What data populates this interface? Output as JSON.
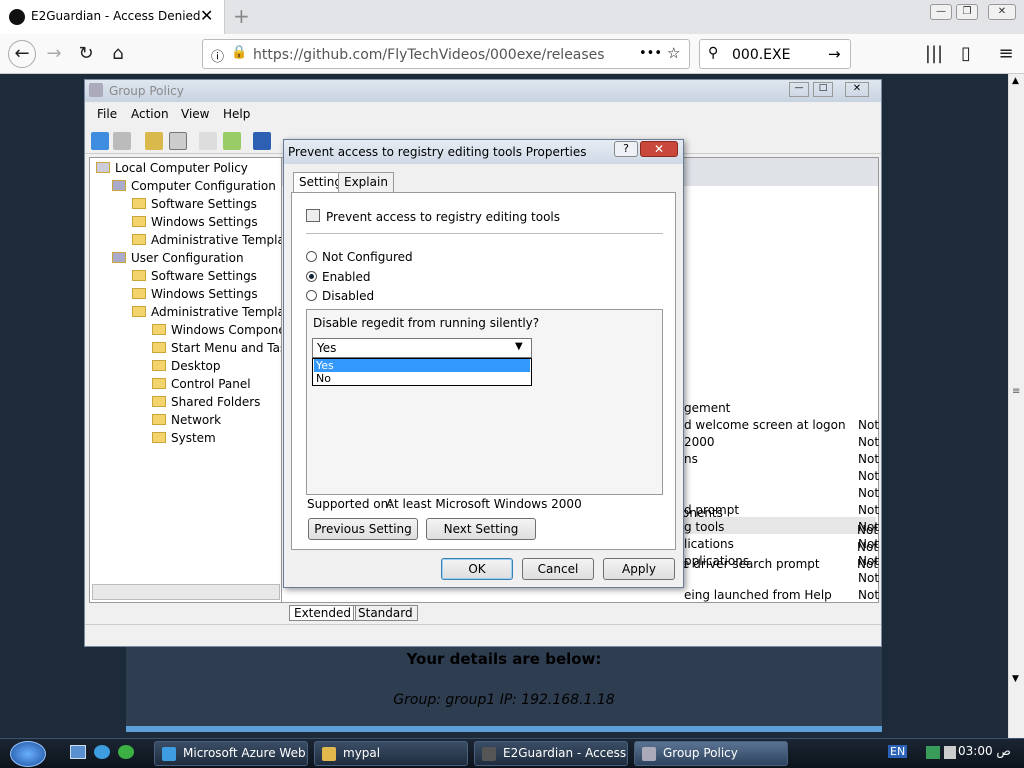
{
  "browser": {
    "tab_title": "E2Guardian - Access Denied",
    "tab_close": "✕",
    "new_tab": "+",
    "url": "https://github.com/FlyTechVideos/000exe/releases",
    "search": "000.EXE",
    "more": "•••"
  },
  "page": {
    "heading": "Your details are below:",
    "details": "Group: group1   IP: 192.168.1.18"
  },
  "gp": {
    "title": "Group Policy",
    "menu": [
      "File",
      "Action",
      "View",
      "Help"
    ],
    "tree": [
      "Local Computer Policy",
      "Computer Configuration",
      "Software Settings",
      "Windows Settings",
      "Administrative Template",
      "User Configuration",
      "Software Settings",
      "Windows Settings",
      "Administrative Template",
      "Windows Componen",
      "Start Menu and Task",
      "Desktop",
      "Control Panel",
      "Shared Folders",
      "Network",
      "System"
    ],
    "right_rows": [
      {
        "name": "gement",
        "state": ""
      },
      {
        "name": "d welcome screen at logon",
        "state": "Not"
      },
      {
        "name": "2000",
        "state": "Not"
      },
      {
        "name": "ns",
        "state": "Not"
      },
      {
        "name": "",
        "state": "Not"
      },
      {
        "name": "",
        "state": "Not"
      },
      {
        "name": "d prompt",
        "state": "Not"
      },
      {
        "name": "g tools",
        "state": "Not"
      },
      {
        "name": "lications",
        "state": "Not"
      },
      {
        "name": "pplications",
        "state": "Not"
      },
      {
        "name": "",
        "state": "Not"
      },
      {
        "name": "eing launched from Help",
        "state": "Not"
      },
      {
        "name": "onents",
        "state": "Not"
      },
      {
        "name": "",
        "state": "Not"
      },
      {
        "name": "e driver search prompt",
        "state": "Not"
      }
    ],
    "tabs": [
      "Extended",
      "Standard"
    ]
  },
  "dialog": {
    "title": "Prevent access to registry editing tools Properties",
    "help": "?",
    "close": "✕",
    "tab_setting": "Setting",
    "tab_explain": "Explain",
    "policy_name": "Prevent access to registry editing tools",
    "radio_not_configured": "Not Configured",
    "radio_enabled": "Enabled",
    "radio_disabled": "Disabled",
    "option_label": "Disable regedit from running silently?",
    "combo_value": "Yes",
    "dropdown": [
      "Yes",
      "No"
    ],
    "supported_label": "Supported on:",
    "supported_value": "At least Microsoft Windows 2000",
    "prev_btn": "Previous Setting",
    "next_btn": "Next Setting",
    "ok": "OK",
    "cancel": "Cancel",
    "apply": "Apply"
  },
  "taskbar": {
    "tasks": [
      "Microsoft Azure Web...",
      "mypal",
      "E2Guardian - Access ...",
      "Group Policy"
    ],
    "lang": "EN",
    "clock": "03:00 ص"
  }
}
